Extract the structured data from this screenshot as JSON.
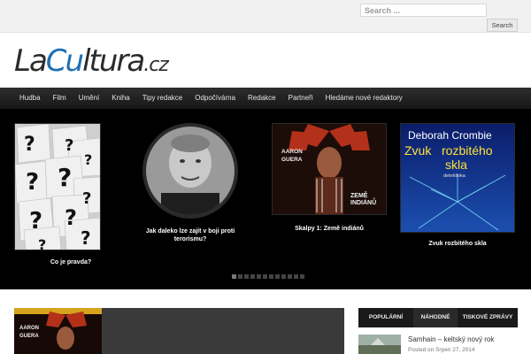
{
  "search": {
    "placeholder": "Search ...",
    "button_label": "Search"
  },
  "logo": {
    "part1": "La",
    "part2": "Cu",
    "part3": "ltura",
    "part4": ".cz"
  },
  "nav": {
    "items": [
      "Hudba",
      "Film",
      "Umění",
      "Kniha",
      "Tipy redakce",
      "Odpočívárna",
      "Redakce",
      "Partneři",
      "Hledáme nové redaktory"
    ]
  },
  "slider": {
    "slides": [
      {
        "caption": "Co je pravda?"
      },
      {
        "caption": "Jak daleko lze zajít v boji proti terorismu?"
      },
      {
        "caption": "Skalpy 1: Země indiánů",
        "cover_top": "AARON",
        "cover_sub": "GUERA",
        "cover_title": "ZEMĚ INDIÁNŮ"
      },
      {
        "caption": "Zvuk rozbitého skla",
        "cover_author": "Deborah Crombie",
        "cover_title_1": "Zvuk",
        "cover_title_2": "rozbitého",
        "cover_title_3": "skla",
        "cover_genre": "detektivka"
      }
    ],
    "dot_count": 12,
    "active_dot": 0
  },
  "feature": {
    "cover_top": "AARON",
    "cover_sub": "GUERA"
  },
  "tabs": {
    "popular": "POPULÁRNÍ",
    "random": "NÁHODNÉ",
    "press": "TISKOVÉ ZPRÁVY"
  },
  "post": {
    "title": "Samhain – keltský nový rok",
    "date": "Posted on Srpen 27, 2014"
  },
  "colors": {
    "nav_bg": "#1f1f1f",
    "logo_accent": "#1f6fb3",
    "slider_bg": "#000000"
  }
}
